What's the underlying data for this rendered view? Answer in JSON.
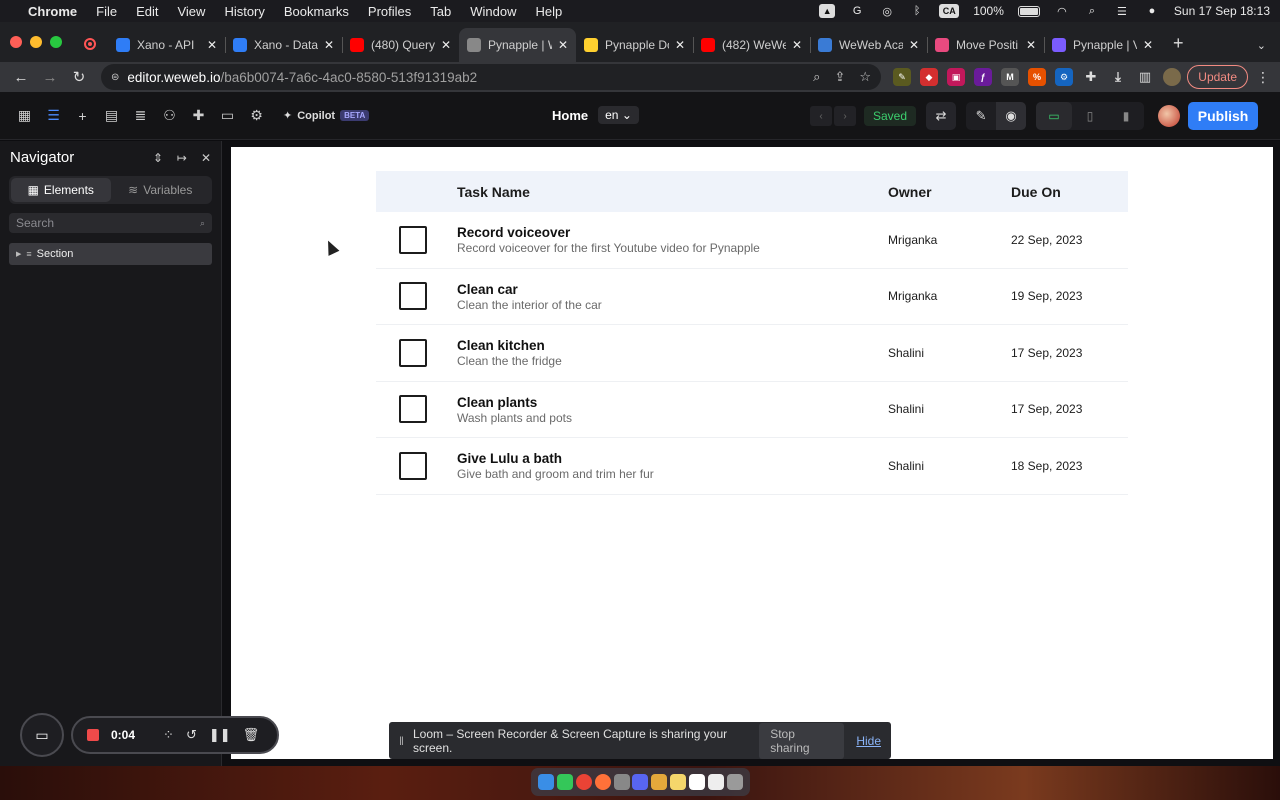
{
  "menubar": {
    "items": [
      "Chrome",
      "File",
      "Edit",
      "View",
      "History",
      "Bookmarks",
      "Profiles",
      "Tab",
      "Window",
      "Help"
    ],
    "ca_label": "CA",
    "battery": "100%",
    "datetime": "Sun 17 Sep  18:13"
  },
  "tabs": [
    {
      "title": "Xano - API",
      "icon": "xano-icon",
      "color": "#2f7df6"
    },
    {
      "title": "Xano - Data",
      "icon": "xano-icon",
      "color": "#2f7df6"
    },
    {
      "title": "(480) Query",
      "icon": "youtube-icon",
      "color": "#ff0000"
    },
    {
      "title": "Pynapple | W",
      "icon": "weweb-icon",
      "color": "#888888",
      "active": true
    },
    {
      "title": "Pynapple Do",
      "icon": "miro-icon",
      "color": "#ffd02f"
    },
    {
      "title": "(482) WeWe",
      "icon": "youtube-icon",
      "color": "#ff0000"
    },
    {
      "title": "WeWeb Aca",
      "icon": "weweb-academy-icon",
      "color": "#3a7bd5"
    },
    {
      "title": "Move Positi",
      "icon": "move-icon",
      "color": "#e84a7f"
    },
    {
      "title": "Pynapple | V",
      "icon": "gear-purple-icon",
      "color": "#7b5cff"
    }
  ],
  "omnibox": {
    "host": "editor.weweb.io",
    "path": "/ba6b0074-7a6c-4ac0-8580-513f91319ab2"
  },
  "update_label": "Update",
  "editor": {
    "copilot_label": "Copilot",
    "beta_label": "BETA",
    "page_name": "Home",
    "language": "en",
    "saved_label": "Saved",
    "publish_label": "Publish"
  },
  "navigator": {
    "title": "Navigator",
    "tab_elements": "Elements",
    "tab_variables": "Variables",
    "search_placeholder": "Search",
    "tree_item": "Section"
  },
  "table": {
    "headers": {
      "name": "Task Name",
      "owner": "Owner",
      "due": "Due On"
    },
    "rows": [
      {
        "title": "Record voiceover",
        "desc": "Record voiceover for the first Youtube video for Pynapple",
        "owner": "Mriganka",
        "due": "22 Sep, 2023"
      },
      {
        "title": "Clean car",
        "desc": "Clean the interior of the car",
        "owner": "Mriganka",
        "due": "19 Sep, 2023"
      },
      {
        "title": "Clean kitchen",
        "desc": "Clean the the fridge",
        "owner": "Shalini",
        "due": "17 Sep, 2023"
      },
      {
        "title": "Clean plants",
        "desc": "Wash plants and pots",
        "owner": "Shalini",
        "due": "17 Sep, 2023"
      },
      {
        "title": "Give Lulu a bath",
        "desc": "Give bath and groom and trim her fur",
        "owner": "Shalini",
        "due": "18 Sep, 2023"
      }
    ]
  },
  "loom": {
    "timer": "0:04",
    "share_text": "Loom – Screen Recorder & Screen Capture is sharing your screen.",
    "stop_label": "Stop sharing",
    "hide_label": "Hide"
  },
  "colors": {
    "accent": "#2f7df6",
    "saved": "#3ccf6e",
    "rec": "#ef4a4a"
  }
}
